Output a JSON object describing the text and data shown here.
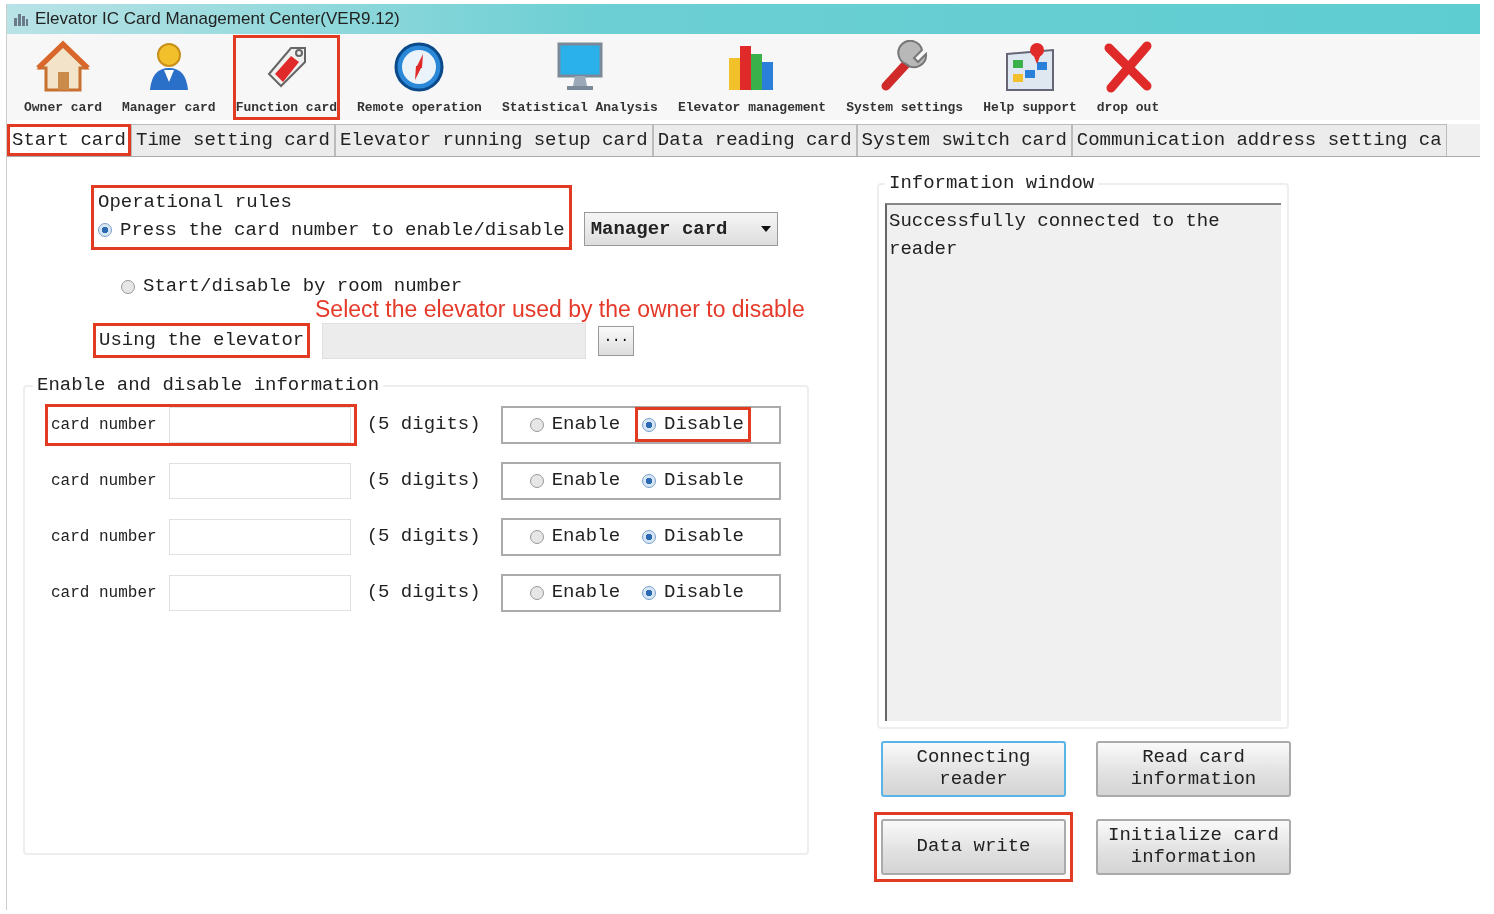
{
  "window": {
    "title": "Elevator IC Card Management Center(VER9.12)"
  },
  "toolbar": [
    {
      "label": "Owner card",
      "kind": "house",
      "highlighted": false
    },
    {
      "label": "Manager card",
      "kind": "person",
      "highlighted": false
    },
    {
      "label": "Function card",
      "kind": "tag",
      "highlighted": true
    },
    {
      "label": "Remote operation",
      "kind": "compass",
      "highlighted": false
    },
    {
      "label": "Statistical Analysis",
      "kind": "monitor",
      "highlighted": false
    },
    {
      "label": "Elevator management",
      "kind": "bars",
      "highlighted": false
    },
    {
      "label": "System settings",
      "kind": "wrench",
      "highlighted": false
    },
    {
      "label": "Help support",
      "kind": "map",
      "highlighted": false
    },
    {
      "label": "drop out",
      "kind": "cross",
      "highlighted": false
    }
  ],
  "tabs": [
    {
      "label": "Start card",
      "selected": true,
      "highlighted": true
    },
    {
      "label": "Time setting card",
      "selected": false,
      "highlighted": false
    },
    {
      "label": "Elevator running setup card",
      "selected": false,
      "highlighted": false
    },
    {
      "label": "Data reading card",
      "selected": false,
      "highlighted": false
    },
    {
      "label": "System switch card",
      "selected": false,
      "highlighted": false
    },
    {
      "label": "Communication address setting ca",
      "selected": false,
      "highlighted": false
    }
  ],
  "operational_rules": {
    "title": "Operational rules",
    "highlighted": true,
    "options": [
      {
        "label": "Press the card number to enable/disable",
        "selected": true
      },
      {
        "label": "Start/disable by room number",
        "selected": false
      }
    ],
    "card_type": {
      "value": "Manager card"
    }
  },
  "annotation": "Select the elevator used by the owner to disable",
  "elevator": {
    "label": "Using the elevator",
    "highlighted": true,
    "browse": "···"
  },
  "enable_info": {
    "title": "Enable and disable information",
    "rows": [
      {
        "label": "card number",
        "hint": "(5 digits)",
        "highlighted": true,
        "options": [
          {
            "label": "Enable",
            "selected": false,
            "highlighted": false
          },
          {
            "label": "Disable",
            "selected": true,
            "highlighted": true
          }
        ]
      },
      {
        "label": "card number",
        "hint": "(5 digits)",
        "highlighted": false,
        "options": [
          {
            "label": "Enable",
            "selected": false,
            "highlighted": false
          },
          {
            "label": "Disable",
            "selected": true,
            "highlighted": false
          }
        ]
      },
      {
        "label": "card number",
        "hint": "(5 digits)",
        "highlighted": false,
        "options": [
          {
            "label": "Enable",
            "selected": false,
            "highlighted": false
          },
          {
            "label": "Disable",
            "selected": true,
            "highlighted": false
          }
        ]
      },
      {
        "label": "card number",
        "hint": "(5 digits)",
        "highlighted": false,
        "options": [
          {
            "label": "Enable",
            "selected": false,
            "highlighted": false
          },
          {
            "label": "Disable",
            "selected": true,
            "highlighted": false
          }
        ]
      }
    ]
  },
  "info_window": {
    "title": "Information window",
    "text": "Successfully connected to the reader"
  },
  "buttons": [
    {
      "label": "Connecting reader",
      "focused": true,
      "highlighted": false
    },
    {
      "label": "Read card information",
      "focused": false,
      "highlighted": false
    },
    {
      "label": "Data write",
      "focused": false,
      "highlighted": true
    },
    {
      "label": "Initialize card information",
      "focused": false,
      "highlighted": false
    }
  ]
}
